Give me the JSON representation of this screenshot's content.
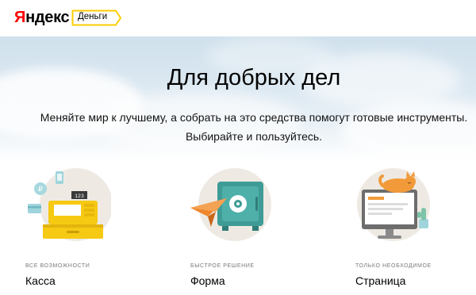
{
  "header": {
    "logo_first": "Я",
    "logo_rest": "ндекс",
    "product": "Деньги"
  },
  "hero": {
    "title": "Для добрых дел",
    "subtitle_line1": "Меняйте мир к лучшему, а собрать на это средства помогут готовые инструменты.",
    "subtitle_line2": "Выбирайте и пользуйтесь."
  },
  "features": [
    {
      "label": "ВСЕ ВОЗМОЖНОСТИ",
      "title": "Касса",
      "icon": "cash-register-icon",
      "display_text": "123"
    },
    {
      "label": "БЫСТРОЕ РЕШЕНИЕ",
      "title": "Форма",
      "icon": "safe-paper-plane-icon"
    },
    {
      "label": "ТОЛЬКО НЕОБХОДИМОЕ",
      "title": "Страница",
      "icon": "webpage-cat-icon"
    }
  ],
  "colors": {
    "brand_red": "#ff0000",
    "tag_border": "#ffcc00",
    "register_yellow": "#f6c913",
    "safe_teal": "#3f9b96",
    "plane_orange": "#f0862b",
    "cat_orange": "#f29a3a",
    "circle_bg": "#eeeae3"
  }
}
